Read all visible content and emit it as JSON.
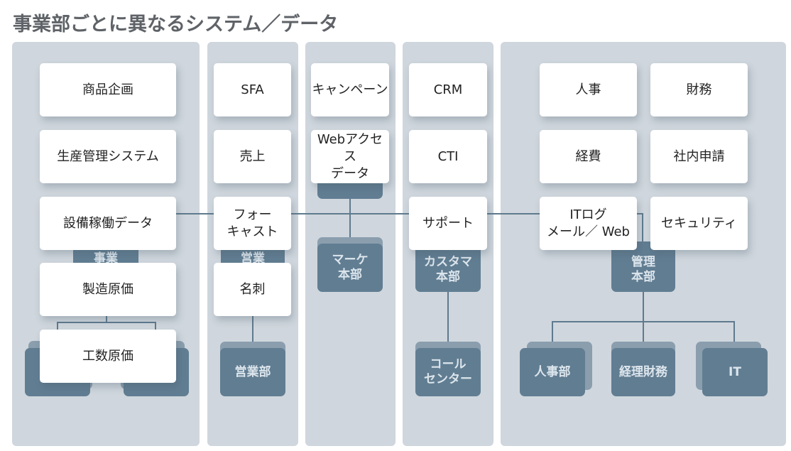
{
  "title": "事業部ごとに異なるシステム／データ",
  "colors": {
    "column_bg": "#cfd6dd",
    "card_bg": "#ffffff",
    "dept_bg": "#617d92",
    "dept_text": "#dce5ec",
    "line": "#5f7a8e",
    "title_text": "#5f6368"
  },
  "columns": [
    {
      "id": "business",
      "systems": [
        "商品企画",
        "生産管理システム",
        "設備稼働データ",
        "製造原価",
        "工数原価"
      ],
      "departments": [
        "事業",
        "",
        ""
      ]
    },
    {
      "id": "sales",
      "systems": [
        "SFA",
        "売上",
        "フォー\nキャスト",
        "名刺"
      ],
      "departments": [
        "営業",
        "営業部"
      ]
    },
    {
      "id": "marketing",
      "systems": [
        "キャンペーン",
        "Webアクセス\nデータ"
      ],
      "departments": [
        "マーケ\n本部"
      ]
    },
    {
      "id": "customer",
      "systems": [
        "CRM",
        "CTI",
        "サポート"
      ],
      "departments": [
        "カスタマ\n本部",
        "コール\nセンター"
      ]
    },
    {
      "id": "admin",
      "systems": [
        "人事",
        "財務",
        "経費",
        "社内申請",
        "ITログ\nメール／ Web",
        "セキュリティ"
      ],
      "departments": [
        "管理\n本部",
        "人事部",
        "経理財務",
        "IT"
      ]
    }
  ]
}
